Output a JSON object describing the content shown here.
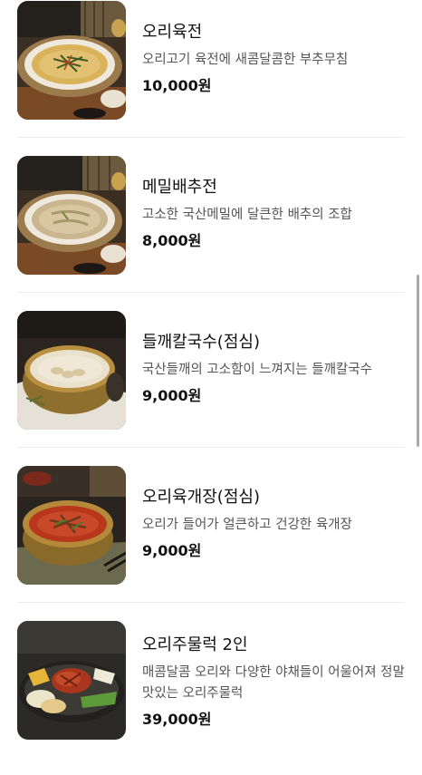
{
  "menu": {
    "items": [
      {
        "name": "오리육전",
        "description": "오리고기 육전에 새콤달콤한 부추무침",
        "price": "10,000원",
        "image_icon": "duck-pancake-photo"
      },
      {
        "name": "메밀배추전",
        "description": "고소한 국산메밀에 달큰한 배추의 조합",
        "price": "8,000원",
        "image_icon": "buckwheat-cabbage-pancake-photo"
      },
      {
        "name": "들깨칼국수(점심)",
        "description": "국산들깨의 고소함이 느껴지는 들깨칼국수",
        "price": "9,000원",
        "image_icon": "perilla-noodle-soup-photo"
      },
      {
        "name": "오리육개장(점심)",
        "description": "오리가 들어가 얼큰하고 건강한 육개장",
        "price": "9,000원",
        "image_icon": "spicy-duck-soup-photo"
      },
      {
        "name": "오리주물럭 2인",
        "description": "매콤달콤 오리와 다양한 야채들이 어울어져 정말 맛있는 오리주물럭",
        "price": "39,000원",
        "image_icon": "spicy-duck-stir-fry-photo"
      }
    ]
  },
  "colors": {
    "divider": "#ededed",
    "price_text": "#111111",
    "description_text": "#555555"
  }
}
